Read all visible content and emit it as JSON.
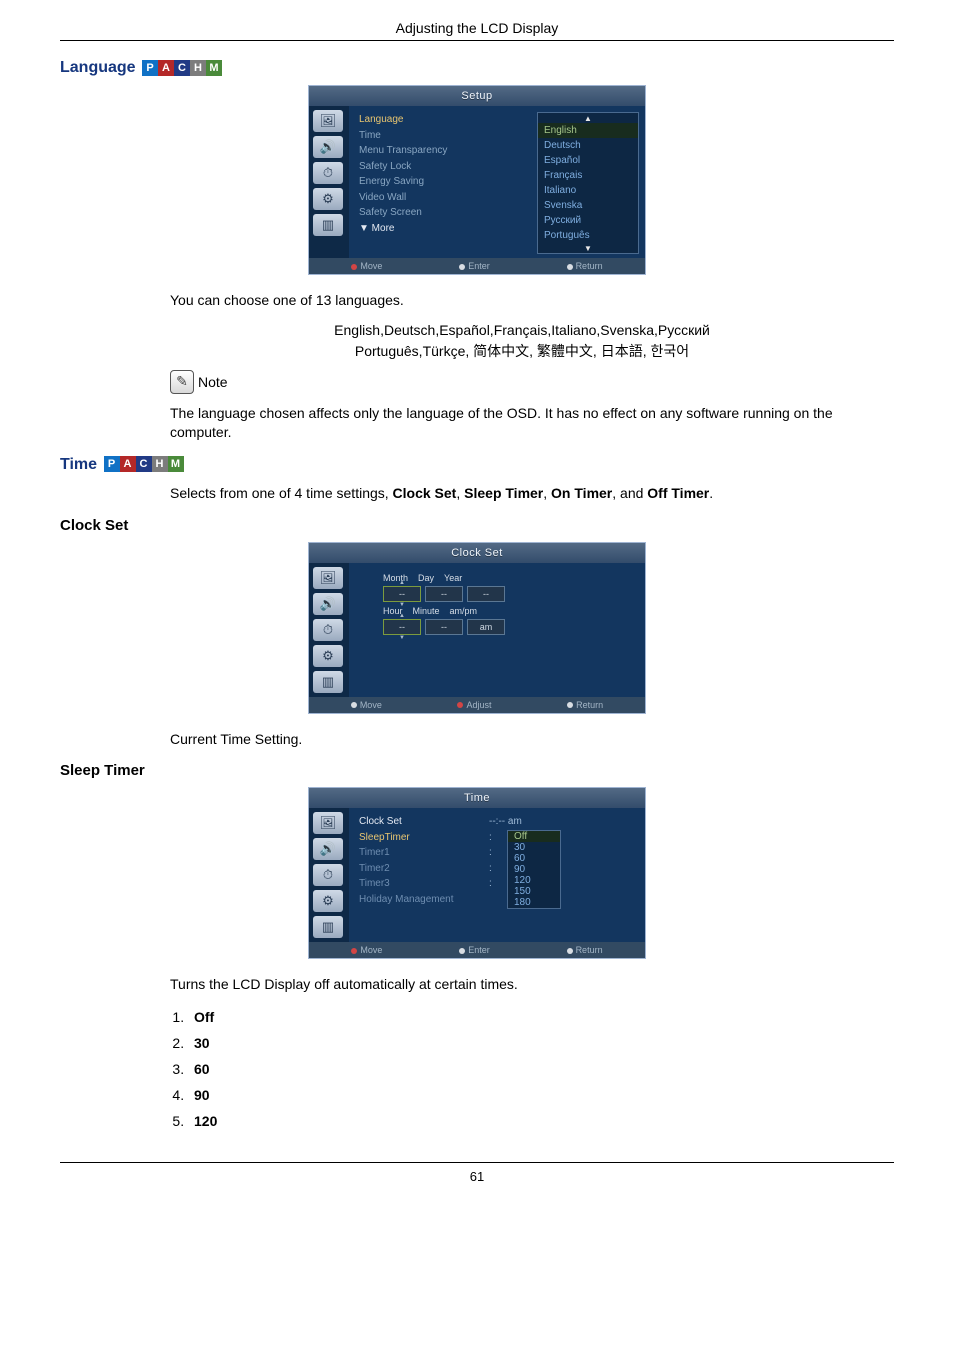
{
  "page_header": "Adjusting the LCD Display",
  "page_number": "61",
  "badges": {
    "p": "P",
    "a": "A",
    "c": "C",
    "h": "H",
    "m": "M"
  },
  "language": {
    "title": "Language",
    "osd_title": "Setup",
    "menu_items": {
      "language": "Language",
      "time": "Time",
      "menu_transparency": "Menu Transparency",
      "safety_lock": "Safety Lock",
      "energy_saving": "Energy Saving",
      "video_wall": "Video Wall",
      "safety_screen": "Safety Screen",
      "more": "▼ More"
    },
    "options": {
      "english": "English",
      "deutsch": "Deutsch",
      "espanol": "Español",
      "francais": "Français",
      "italiano": "Italiano",
      "svenska": "Svenska",
      "russkiy": "Русский",
      "portugues": "Português"
    },
    "footer": {
      "move": "Move",
      "enter": "Enter",
      "return": "Return"
    },
    "text_choose": "You can choose one of 13 languages.",
    "lang_line1": "English,Deutsch,Español,Français,Italiano,Svenska,Русский",
    "lang_line2": "Português,Türkçe, 简体中文,  繁體中文, 日本語, 한국어",
    "note_label": "Note",
    "note_text": "The language chosen affects only the language of the OSD. It has no effect on any software running on the computer."
  },
  "time": {
    "title": "Time",
    "text": "Selects from one of 4 time settings, ",
    "opts": {
      "clock_set": "Clock Set",
      "sleep_timer": "Sleep Timer",
      "on_timer": "On Timer",
      "off_timer": "Off Timer"
    },
    "sep1": ", ",
    "sep_and": ", and ",
    "period": "."
  },
  "clock_set": {
    "title": "Clock Set",
    "osd_title": "Clock Set",
    "labels": {
      "month": "Month",
      "day": "Day",
      "year": "Year",
      "hour": "Hour",
      "minute": "Minute",
      "ampm": "am/pm"
    },
    "vals": {
      "dash": "--",
      "am": "am"
    },
    "footer": {
      "move": "Move",
      "adjust": "Adjust",
      "return": "Return"
    },
    "text": "Current Time Setting."
  },
  "sleep_timer": {
    "title": "Sleep Timer",
    "osd_title": "Time",
    "rows": {
      "clock_set": {
        "label": "Clock Set",
        "val": "--:-- am"
      },
      "sleep_timer": {
        "label": "SleepTimer",
        "val": ":"
      },
      "timer1": {
        "label": "Timer1",
        "val": ":"
      },
      "timer2": {
        "label": "Timer2",
        "val": ":"
      },
      "timer3": {
        "label": "Timer3",
        "val": ":"
      },
      "holiday": {
        "label": "Holiday Management"
      }
    },
    "options": {
      "off": "Off",
      "v30": "30",
      "v60": "60",
      "v90": "90",
      "v120": "120",
      "v150": "150",
      "v180": "180"
    },
    "footer": {
      "move": "Move",
      "enter": "Enter",
      "return": "Return"
    },
    "text": "Turns the LCD Display off automatically at certain times.",
    "list": {
      "i1": "Off",
      "i2": "30",
      "i3": "60",
      "i4": "90",
      "i5": "120"
    }
  }
}
